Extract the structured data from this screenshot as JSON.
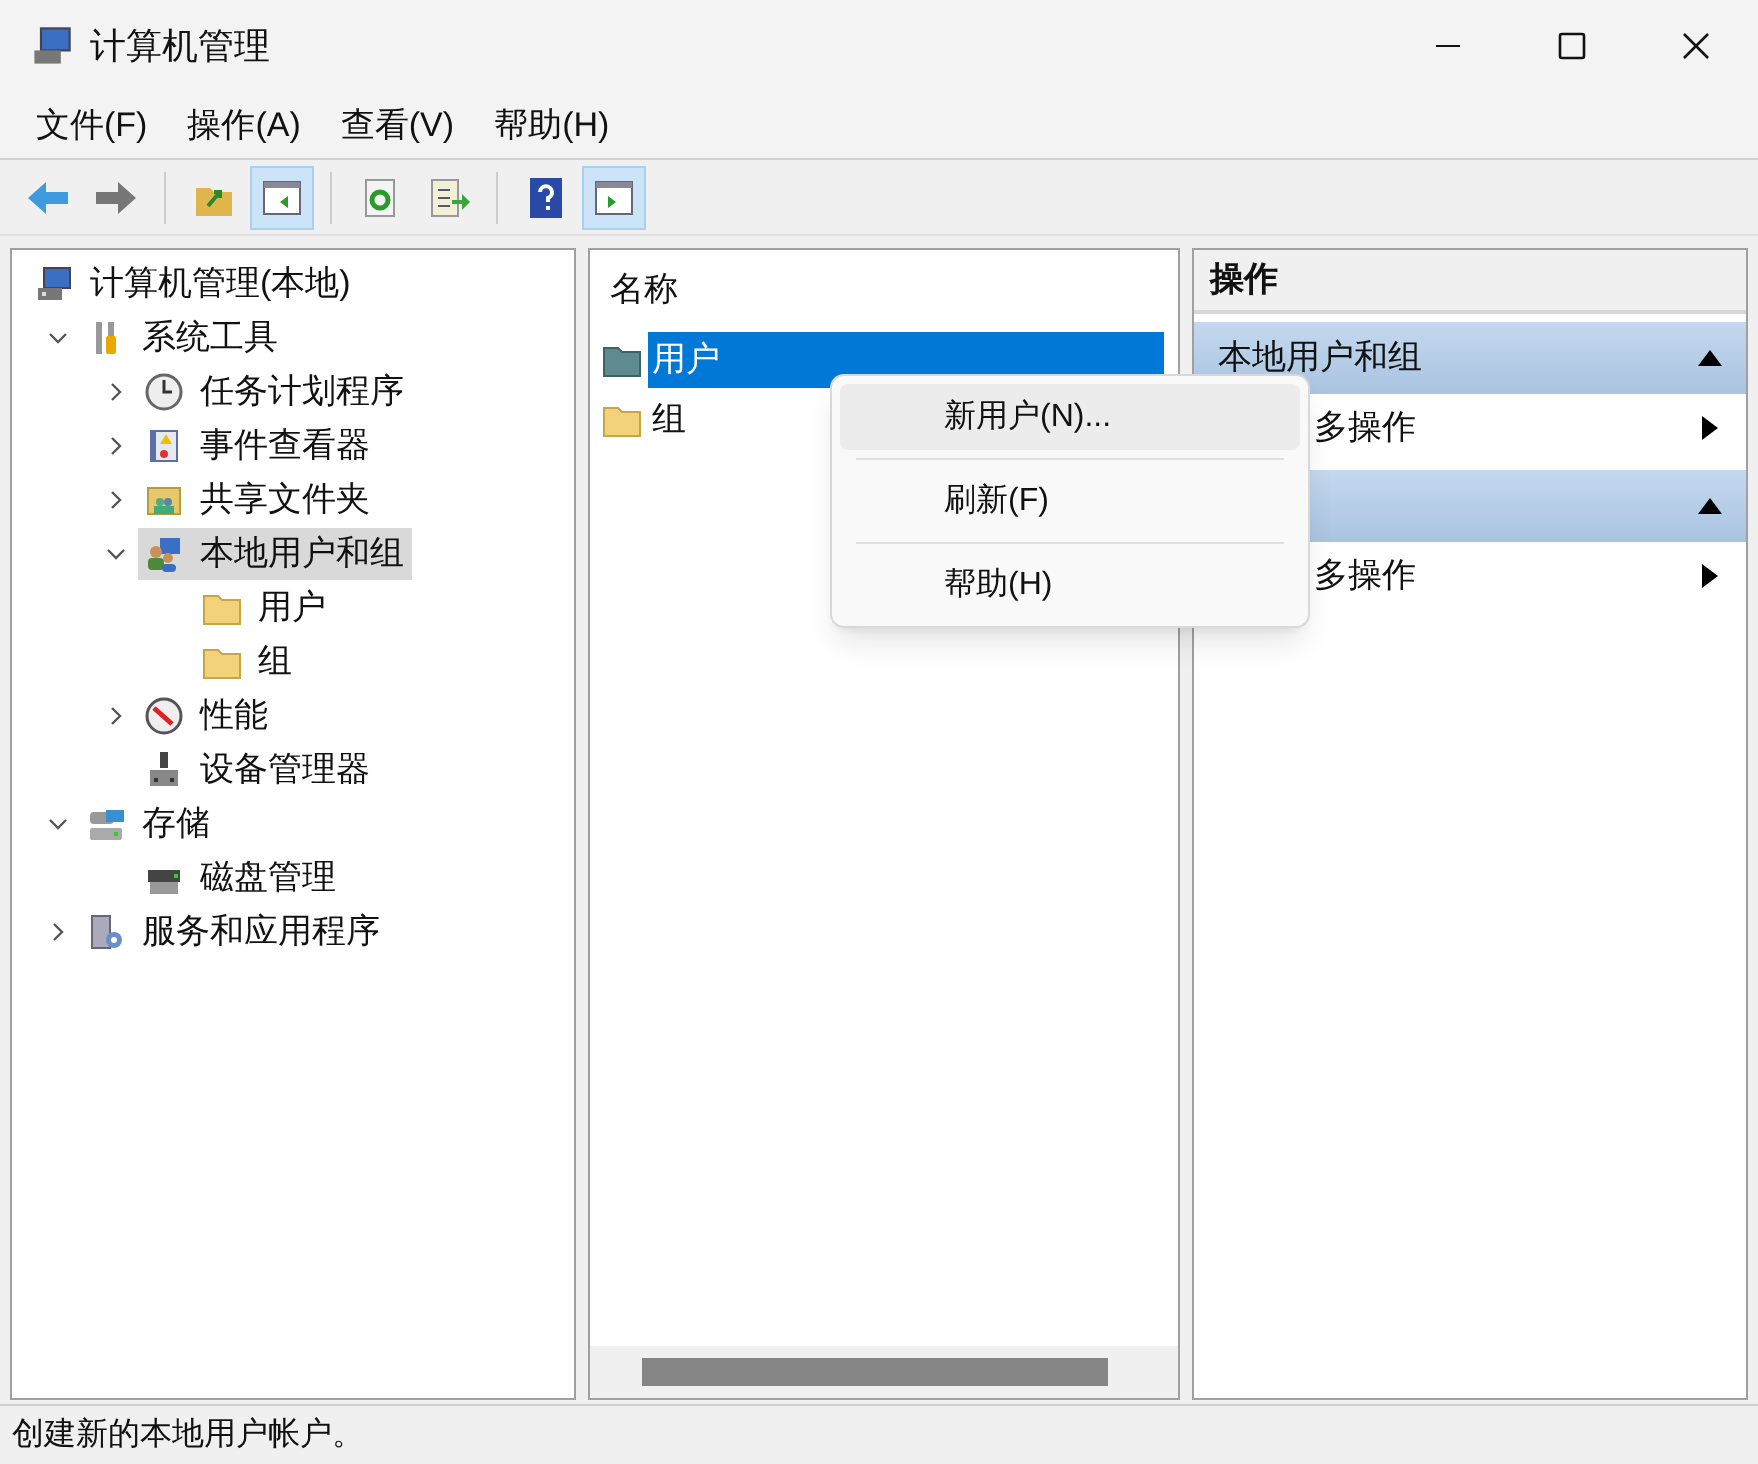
{
  "window": {
    "title": "计算机管理"
  },
  "menu": [
    "文件(F)",
    "操作(A)",
    "查看(V)",
    "帮助(H)"
  ],
  "toolbar": [
    {
      "kind": "back",
      "pressed": false
    },
    {
      "kind": "forward",
      "pressed": false
    },
    {
      "kind": "sep"
    },
    {
      "kind": "up",
      "pressed": false
    },
    {
      "kind": "tree",
      "pressed": true
    },
    {
      "kind": "sep"
    },
    {
      "kind": "refresh",
      "pressed": false
    },
    {
      "kind": "export",
      "pressed": false
    },
    {
      "kind": "sep"
    },
    {
      "kind": "help",
      "pressed": false
    },
    {
      "kind": "action",
      "pressed": true
    }
  ],
  "tree": [
    {
      "label": "计算机管理(本地)",
      "kind": "computer",
      "selected": false,
      "children": [
        {
          "label": "系统工具",
          "kind": "tools",
          "expanded": true,
          "selected": false,
          "children": [
            {
              "label": "任务计划程序",
              "kind": "clock",
              "expanded": false,
              "selected": false
            },
            {
              "label": "事件查看器",
              "kind": "event",
              "expanded": false,
              "selected": false
            },
            {
              "label": "共享文件夹",
              "kind": "share",
              "expanded": false,
              "selected": false
            },
            {
              "label": "本地用户和组",
              "kind": "users",
              "expanded": true,
              "selected": true,
              "children": [
                {
                  "label": "用户",
                  "kind": "folder",
                  "selected": false
                },
                {
                  "label": "组",
                  "kind": "folder",
                  "selected": false
                }
              ]
            },
            {
              "label": "性能",
              "kind": "perf",
              "expanded": false,
              "selected": false
            },
            {
              "label": "设备管理器",
              "kind": "device",
              "selected": false
            }
          ]
        },
        {
          "label": "存储",
          "kind": "storage",
          "expanded": true,
          "selected": false,
          "children": [
            {
              "label": "磁盘管理",
              "kind": "disk",
              "selected": false
            }
          ]
        },
        {
          "label": "服务和应用程序",
          "kind": "services",
          "expanded": false,
          "selected": false
        }
      ]
    }
  ],
  "list": {
    "columns": [
      "名称"
    ],
    "rows": [
      {
        "name": "用户",
        "kind": "userfolder",
        "selected": true
      },
      {
        "name": "组",
        "kind": "folder",
        "selected": false
      }
    ]
  },
  "context_menu": [
    {
      "label": "新用户(N)...",
      "highlighted": true
    },
    {
      "label": "刷新(F)",
      "highlighted": false
    },
    {
      "label": "帮助(H)",
      "highlighted": false
    }
  ],
  "actions": {
    "title": "操作",
    "sections": [
      {
        "header": "本地用户和组",
        "items": [
          "多操作"
        ]
      },
      {
        "items": [
          "多操作"
        ]
      }
    ]
  },
  "status_bar": "创建新的本地用户帐户。"
}
